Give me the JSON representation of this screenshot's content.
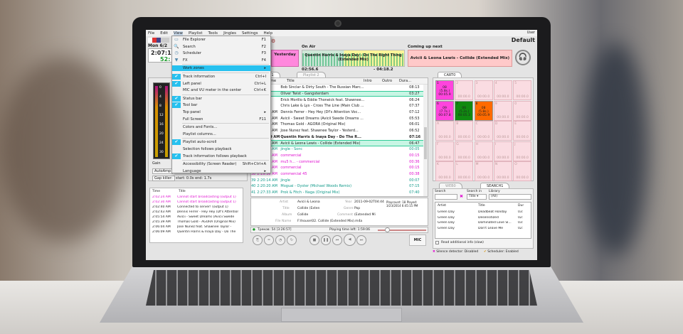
{
  "menubar": [
    "File",
    "Edit",
    "View",
    "Playlist",
    "Tools",
    "Jingles",
    "Settings",
    "Help"
  ],
  "user": {
    "label": "User",
    "profile": "Default"
  },
  "clock": {
    "date": "Mon 6/2",
    "time": "2:07:1",
    "sub": "52:"
  },
  "previous": {
    "label": "Yesterday"
  },
  "on_air": {
    "label": "On Air",
    "track": "Quentin Harris & Inaya Day - Do The Right Thing (Extended Mix)",
    "elapsed": "02:56.6",
    "remaining": "- 04:18.2",
    "progress": 0.41
  },
  "coming_up": {
    "label": "Coming up next",
    "track": "Avicii & Leona Lewis - Collide (Extended Mix)"
  },
  "view_menu": [
    {
      "label": "File Explorer",
      "shortcut": "F1",
      "icon": "folder-icon"
    },
    {
      "label": "Search",
      "shortcut": "F2",
      "icon": "search-icon"
    },
    {
      "label": "Scheduler",
      "shortcut": "F3",
      "icon": "scheduler-icon"
    },
    {
      "label": "FX",
      "shortcut": "F4",
      "icon": "fx-icon"
    },
    {
      "label": "Work zones",
      "shortcut": "▸",
      "highlight": true
    },
    {
      "label": "Track information",
      "shortcut": "Ctrl+I",
      "checked": true
    },
    {
      "label": "Left panel",
      "shortcut": "Ctrl+L",
      "checked": true
    },
    {
      "label": "MIC and VU meter in the center",
      "shortcut": "Ctrl+K"
    },
    {
      "label": "Status bar",
      "shortcut": "",
      "checked": true
    },
    {
      "label": "Tool bar",
      "shortcut": "",
      "checked": true
    },
    {
      "label": "Top panel",
      "shortcut": "▸"
    },
    {
      "label": "Full Screen",
      "shortcut": "F11"
    },
    {
      "label": "Colors and Fonts...",
      "shortcut": ""
    },
    {
      "label": "Playlist columns...",
      "shortcut": ""
    },
    {
      "label": "Playlist auto-scroll",
      "shortcut": "",
      "checked": true
    },
    {
      "label": "Selection follows playback",
      "shortcut": ""
    },
    {
      "label": "Track information follows playback",
      "shortcut": "",
      "checked": true
    },
    {
      "label": "Accessibility (Screen Reader)",
      "shortcut": "Shift+Ctrl+A"
    },
    {
      "label": "Language",
      "shortcut": "▸"
    }
  ],
  "left": {
    "vu_ticks": [
      "0",
      "4",
      "8",
      "12",
      "16",
      "20",
      "24",
      "30"
    ],
    "gain": "Gain",
    "autoamp": "AutoAmp",
    "gap_killer": "Gap killer:",
    "gap_value": "start: 0.0s end: 1.7s"
  },
  "log": {
    "headers": [
      "Time",
      "Title"
    ],
    "rows": [
      {
        "time": "2:02:24 AM",
        "title": "Cannot start broadcasting (output 1)",
        "err": true
      },
      {
        "time": "2:02:30 AM",
        "title": "Cannot start broadcasting (output 1)",
        "err": true
      },
      {
        "time": "2:02:40 AM",
        "title": "Connected to server! (output 1)"
      },
      {
        "time": "2:02:43 AM",
        "title": "Dennis Ferrer - Hey Hey (Df's Attention"
      },
      {
        "time": "2:05:54 AM",
        "title": "Avicii - Sweet Dreams (Avicii Swede"
      },
      {
        "time": "2:05:39 AM",
        "title": "Thomas Gold - AGORA (Original Mix)"
      },
      {
        "time": "2:06:04 AM",
        "title": "Jose Nunez feat. Shawnee Taylor -"
      },
      {
        "time": "2:06:09 AM",
        "title": "Quentin Harris & Inaya Day - Do The"
      }
    ]
  },
  "playlist": {
    "tabs": [
      "Playlist 1",
      "Playlist 2"
    ],
    "headers": [
      "#",
      "Start time",
      "Title",
      "Intro",
      "Outro",
      "Dura..."
    ],
    "rows": [
      {
        "n": "",
        "start": "",
        "title": "Bob Sinclar & Dirty South - The Russian Marc...",
        "dur": "08:13"
      },
      {
        "n": "",
        "start": "",
        "title": "Oliver Twist - Gangsterdam",
        "dur": "03:27",
        "hl": true
      },
      {
        "n": "",
        "start": "",
        "title": "Erick Morillo & Eddie Thoneick feat. Shawnee...",
        "dur": "06:24"
      },
      {
        "n": "",
        "start": "",
        "title": "Chris Lake & Lys - Cross The Line (Main Club ...",
        "dur": "07:37"
      },
      {
        "n": "",
        "start": "2:02:44 AM",
        "title": "Dennis Ferrer - Hey Hey (Df's Attention Voc...",
        "dur": "07:12"
      },
      {
        "n": "",
        "start": "2:05:54 AM",
        "title": "Avicii - Sweet Dreams (Avicii Swede Dreams ...",
        "dur": "05:53"
      },
      {
        "n": "",
        "start": "2:05:39 AM",
        "title": "Thomas Gold - AGORA (Original Mix)",
        "dur": "06:01"
      },
      {
        "n": "",
        "start": "2:06:05 AM",
        "title": "Jose Nunez feat. Shawnee Taylor - Yesterd...",
        "dur": "06:52"
      },
      {
        "n": "",
        "start": "2:06:09 AM",
        "title": "Quentin Harris & Inaya Day - Do The R...",
        "dur": "07:16",
        "bold": true
      },
      {
        "n": "",
        "start": "2:11:24 AM",
        "title": "Avicii & Leona Lewis - Collide (Extended Mix)",
        "dur": "06:47",
        "hl": true
      },
      {
        "n": "",
        "start": "2:18:22 AM",
        "title": "jingle - Sonc",
        "dur": "00:05",
        "c": "teal"
      },
      {
        "n": "",
        "start": "2:18:27 AM",
        "title": "commercial",
        "dur": "00:15",
        "c": "mag"
      },
      {
        "n": "",
        "start": "2:18:43 AM",
        "title": "mu5 h... - commercial",
        "dur": "00:36",
        "c": "mag"
      },
      {
        "n": "",
        "start": "2:19:20 AM",
        "title": "commercial",
        "dur": "00:15",
        "c": "mag"
      },
      {
        "n": "38",
        "start": "2:19:36 AM",
        "title": "commercial 45",
        "dur": "00:38",
        "c": "mag"
      },
      {
        "n": "39",
        "start": "2:20:14 AM",
        "title": "jingle",
        "dur": "00:07",
        "c": "teal"
      },
      {
        "n": "40",
        "start": "2:20:20 AM",
        "title": "Moguai - Oyster (Michael Woods Remix)",
        "dur": "07:15",
        "c": "teal"
      },
      {
        "n": "41",
        "start": "2:27:33 AM",
        "title": "Prok & Fitch - Naga (Original Mix)",
        "dur": "07:40",
        "c": "teal"
      }
    ]
  },
  "info": {
    "artist_l": "Artist",
    "artist": "Avicii & Leona",
    "title_l": "Title",
    "title": "Collide (Exten",
    "album_l": "Album",
    "album": "Collide",
    "file_l": "File Name",
    "file": "F:\\house\\02. Collide (Extended Mix).m4a",
    "year_l": "Year",
    "year": "2011-09-02T04:44",
    "genre_l": "Genre",
    "genre": "Pop",
    "comment_l": "Comment",
    "comment": "(Extended Mi",
    "playcount": "Playcount: 18  Played: 3/23/2014 6:45:15 PM"
  },
  "status": {
    "tracks": "Треков: 54 [3:26:57]",
    "time_left": "Playing time left: 1:59:06",
    "volume": 0.15,
    "mic": "MIC"
  },
  "cart": {
    "tab": "CART0",
    "cells": [
      {
        "k": "1",
        "c": "08\n(5.8s.)\n00:05.9",
        "bg": "#ff44dd"
      },
      {
        "k": "2",
        "t": "00:00.0"
      },
      {
        "k": "3",
        "t": "00:00.0"
      },
      {
        "k": "4",
        "t": "00:00.0"
      },
      {
        "k": "5",
        "t": "00:00.0"
      },
      {
        "k": "6",
        "c": "09\n(7.7s.)\n00:07.8",
        "bg": "#ff44dd"
      },
      {
        "k": "7",
        "c": "06\n(5.2s.)\n00:05.3",
        "bg": "#108a10"
      },
      {
        "k": "8",
        "c": "08\n(5.8s.)\n00:05.9",
        "bg": "#ff6a00"
      },
      {
        "k": "9",
        "t": "00:00.0"
      },
      {
        "k": "0",
        "t": "00:00.0"
      },
      {
        "k": "A",
        "t": "00:00.0"
      },
      {
        "k": "B",
        "t": "00:00.0"
      },
      {
        "k": "C",
        "t": "00:00.0"
      },
      {
        "k": "D",
        "t": "00:00.0"
      },
      {
        "k": "E",
        "t": "00:00.0"
      },
      {
        "k": "F",
        "t": "00:00.0"
      },
      {
        "k": "G",
        "t": "00:00.0"
      },
      {
        "k": "H",
        "t": "00:00.0"
      },
      {
        "k": "I",
        "t": "00:00.0"
      },
      {
        "k": "J",
        "t": "00:00.0"
      },
      {
        "k": "K",
        "t": "00:00.0"
      },
      {
        "k": "L",
        "t": "00:00.0"
      },
      {
        "k": "M",
        "t": "00:00.0"
      },
      {
        "k": "N",
        "t": "00:00.0"
      },
      {
        "k": "O",
        "t": "00:00.0"
      }
    ]
  },
  "search": {
    "tabs": [
      "WEB0",
      "SEARCH1"
    ],
    "search_l": "Search",
    "search_in_l": "Search in",
    "search_in": "Title",
    "library_l": "Library",
    "library": "(All)",
    "headers": [
      "Artist",
      "Title",
      "Dur"
    ],
    "rows": [
      {
        "artist": "Green Day",
        "title": "Deadbeat Holiday",
        "dur": "03:"
      },
      {
        "artist": "Green Day",
        "title": "Desensitized",
        "dur": "02:"
      },
      {
        "artist": "Green Day",
        "title": "Dominated Love Sl...",
        "dur": "03:"
      },
      {
        "artist": "Green Day",
        "title": "Don't Leave Me",
        "dur": "02:"
      }
    ],
    "read_info": "Read additional info (slow)"
  },
  "bottom": {
    "silence": "Silence detector: Disabled",
    "scheduler": "Scheduler: Enabled"
  },
  "colors": {
    "accent": "#27c1ef",
    "highlight": "#c8f5e4",
    "magenta": "#e010d0",
    "teal": "#129a8a"
  }
}
